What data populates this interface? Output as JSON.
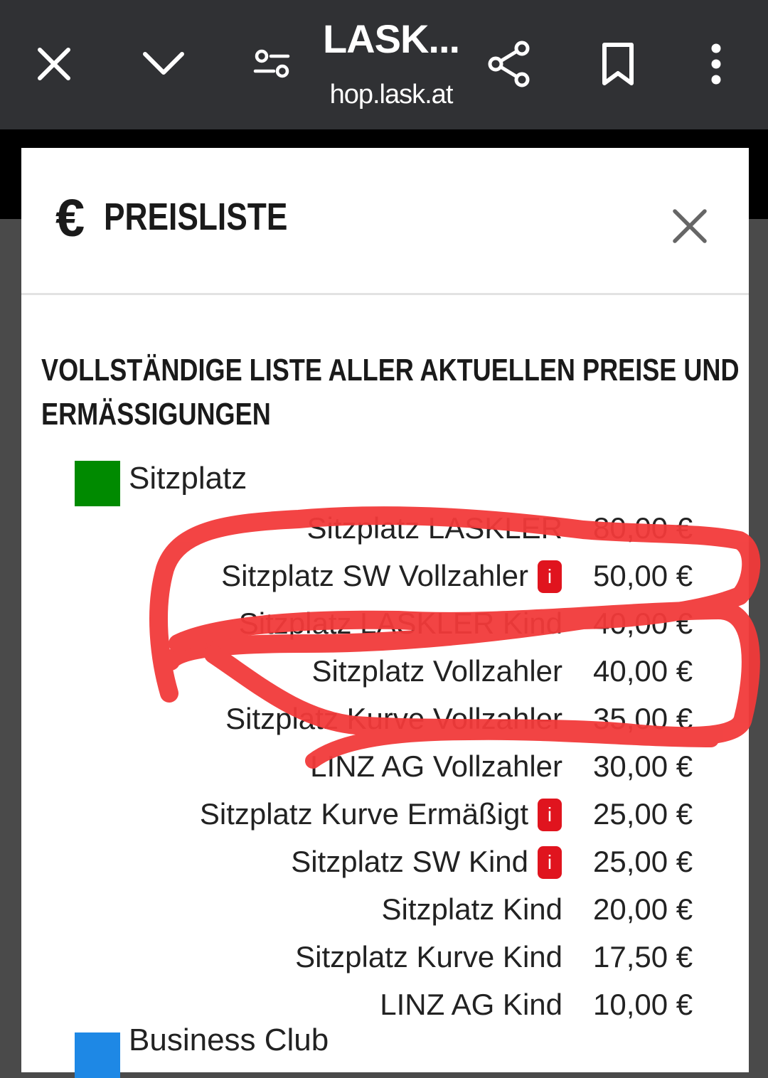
{
  "browser": {
    "title": "LASK...",
    "url": "hop.lask.at"
  },
  "modal": {
    "title": "PREISLISTE",
    "currency_symbol": "€",
    "section_title_line1": "VOLLSTÄNDIGE LISTE ALLER AKTUELLEN PREISE UND",
    "section_title_line2": "ERMÄSSIGUNGEN"
  },
  "categories": [
    {
      "label": "Sitzplatz",
      "color": "#008a00",
      "prices": [
        {
          "name": "Sitzplatz LASKLER",
          "price": "80,00 €",
          "info": false
        },
        {
          "name": "Sitzplatz SW Vollzahler",
          "price": "50,00 €",
          "info": true
        },
        {
          "name": "Sitzplatz LASKLER Kind",
          "price": "40,00 €",
          "info": false
        },
        {
          "name": "Sitzplatz Vollzahler",
          "price": "40,00 €",
          "info": false
        },
        {
          "name": "Sitzplatz Kurve Vollzahler",
          "price": "35,00 €",
          "info": false
        },
        {
          "name": "LINZ AG Vollzahler",
          "price": "30,00 €",
          "info": false
        },
        {
          "name": "Sitzplatz Kurve Ermäßigt",
          "price": "25,00 €",
          "info": true
        },
        {
          "name": "Sitzplatz SW Kind",
          "price": "25,00 €",
          "info": true
        },
        {
          "name": "Sitzplatz Kind",
          "price": "20,00 €",
          "info": false
        },
        {
          "name": "Sitzplatz Kurve Kind",
          "price": "17,50 €",
          "info": false
        },
        {
          "name": "LINZ AG Kind",
          "price": "10,00 €",
          "info": false
        }
      ]
    },
    {
      "label": "Business Club",
      "color": "#1e88e5"
    }
  ],
  "info_glyph": "i",
  "annotation": {
    "color": "#f23a3a"
  }
}
